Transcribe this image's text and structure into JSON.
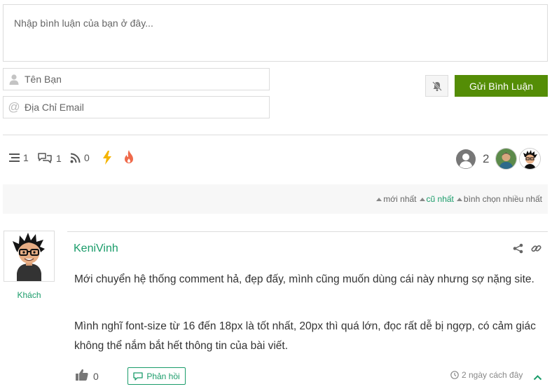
{
  "form": {
    "comment_placeholder": "Nhập bình luận của bạn ở đây...",
    "name_placeholder": "Tên Bạn",
    "email_placeholder": "Địa Chỉ Email",
    "submit_label": "Gửi Bình Luận"
  },
  "stats": {
    "threads": "1",
    "replies": "1",
    "rss": "0",
    "users_count": "2"
  },
  "sort": {
    "newest": "mới nhất",
    "oldest": "cũ nhất",
    "most_voted": "bình chọn nhiều nhất"
  },
  "comment": {
    "author": "KeniVinh",
    "role": "Khách",
    "paragraph1": "Mới chuyển hệ thống comment hả, đẹp đấy, mình cũng muốn dùng cái này nhưng sợ nặng site.",
    "paragraph2": "Mình nghĩ font-size từ 16 đến 18px là tốt nhất, 20px thì quá lớn, đọc rất dễ bị ngợp, có cảm giác không thể nắm bắt hết thông tin của bài viết.",
    "likes": "0",
    "reply_label": "Phản hồi",
    "time": "2 ngày cách đây"
  },
  "colors": {
    "accent": "#1a9c6a",
    "submit_bg": "#548d06",
    "hot": "#f5b400",
    "fire": "#ef6a4b"
  }
}
